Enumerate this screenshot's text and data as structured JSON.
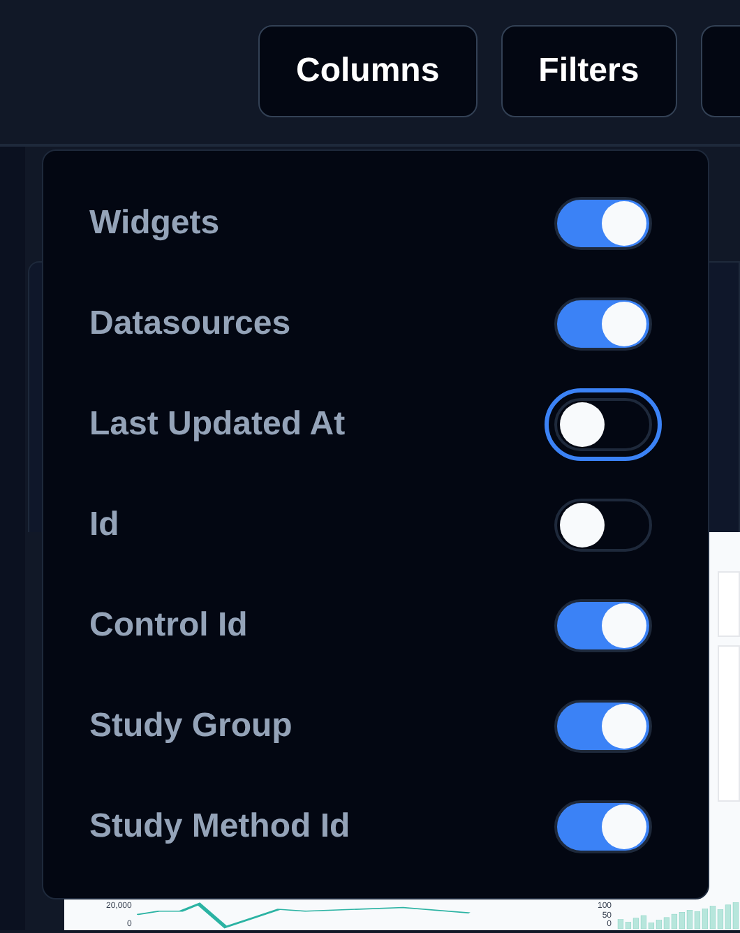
{
  "toolbar": {
    "buttons": [
      {
        "label": "Columns"
      },
      {
        "label": "Filters"
      }
    ]
  },
  "columns_menu": {
    "items": [
      {
        "label": "Widgets",
        "on": true,
        "focused": false
      },
      {
        "label": "Datasources",
        "on": true,
        "focused": false
      },
      {
        "label": "Last Updated At",
        "on": false,
        "focused": true
      },
      {
        "label": "Id",
        "on": false,
        "focused": false
      },
      {
        "label": "Control Id",
        "on": true,
        "focused": false
      },
      {
        "label": "Study Group",
        "on": true,
        "focused": false
      },
      {
        "label": "Study Method Id",
        "on": true,
        "focused": false
      }
    ]
  },
  "background_charts": {
    "line_chart_ticks": [
      "20,000",
      "0"
    ],
    "bar_chart_ticks": [
      "100",
      "50",
      "0"
    ]
  }
}
